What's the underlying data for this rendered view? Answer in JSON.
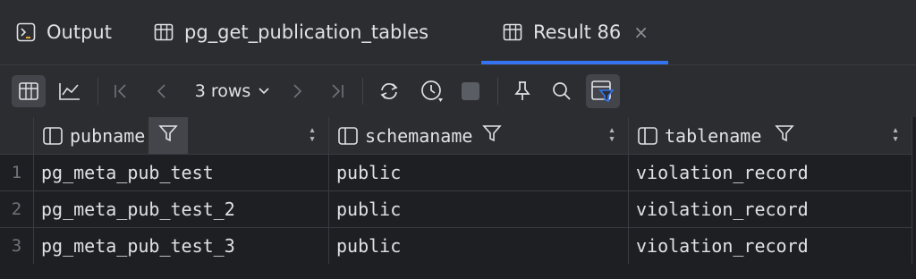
{
  "tabs": [
    {
      "label": "Output",
      "icon": "console-icon"
    },
    {
      "label": "pg_get_publication_tables",
      "icon": "table-icon"
    },
    {
      "label": "Result 86",
      "icon": "table-icon",
      "active": true,
      "close": "×"
    }
  ],
  "toolbar": {
    "rows_label": "3 rows",
    "icons": [
      "table-view-icon",
      "chart-view-icon",
      "first-page-icon",
      "prev-page-icon",
      "next-page-icon",
      "last-page-icon",
      "refresh-icon",
      "history-icon",
      "stop-icon",
      "pin-icon",
      "search-icon",
      "filter-icon"
    ]
  },
  "grid": {
    "columns": [
      "pubname",
      "schemaname",
      "tablename"
    ],
    "rows": [
      {
        "num": "1",
        "cells": [
          "pg_meta_pub_test",
          "public",
          "violation_record"
        ]
      },
      {
        "num": "2",
        "cells": [
          "pg_meta_pub_test_2",
          "public",
          "violation_record"
        ]
      },
      {
        "num": "3",
        "cells": [
          "pg_meta_pub_test_3",
          "public",
          "violation_record"
        ]
      }
    ]
  },
  "colors": {
    "accent": "#3574f0",
    "bg": "#1e1f22",
    "panel": "#2b2d30",
    "text": "#dfe1e5"
  }
}
